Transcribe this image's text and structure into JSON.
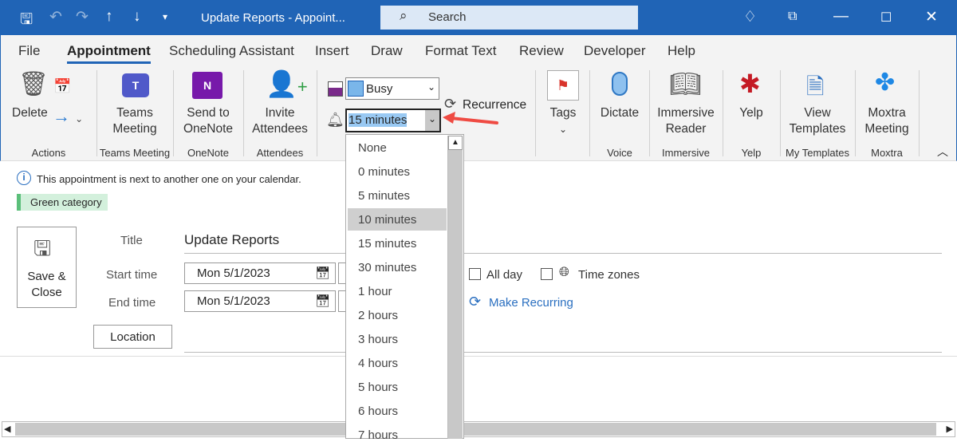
{
  "titlebar": {
    "title": "Update Reports  -  Appoint...",
    "search_placeholder": "Search"
  },
  "menu": {
    "tabs": [
      "File",
      "Appointment",
      "Scheduling Assistant",
      "Insert",
      "Draw",
      "Format Text",
      "Review",
      "Developer",
      "Help"
    ],
    "active": "Appointment"
  },
  "ribbon": {
    "delete": "Delete",
    "teams": [
      "Teams",
      "Meeting"
    ],
    "onenote": [
      "Send to",
      "OneNote"
    ],
    "invite": [
      "Invite",
      "Attendees"
    ],
    "show_as": "Busy",
    "reminder": "15 minutes",
    "recurrence": "Recurrence",
    "tags": "Tags",
    "dictate": "Dictate",
    "immersive": [
      "Immersive",
      "Reader"
    ],
    "yelp": "Yelp",
    "templates": [
      "View",
      "Templates"
    ],
    "moxtra": [
      "Moxtra",
      "Meeting"
    ],
    "groups": [
      "Actions",
      "Teams Meeting",
      "OneNote",
      "Attendees",
      "Voice",
      "Immersive",
      "Yelp",
      "My Templates",
      "Moxtra"
    ]
  },
  "reminder_options": [
    "None",
    "0 minutes",
    "5 minutes",
    "10 minutes",
    "15 minutes",
    "30 minutes",
    "1 hour",
    "2 hours",
    "3 hours",
    "4 hours",
    "5 hours",
    "6 hours",
    "7 hours"
  ],
  "highlighted_option": "10 minutes",
  "form": {
    "info": "This appointment is next to another one on your calendar.",
    "category": "Green category",
    "category_color": "#5bbf7a",
    "save_close": [
      "Save &",
      "Close"
    ],
    "title_label": "Title",
    "title_value": "Update Reports",
    "start_label": "Start time",
    "start_date": "Mon 5/1/2023",
    "end_label": "End time",
    "end_date": "Mon 5/1/2023",
    "all_day": "All day",
    "time_zones": "Time zones",
    "make_recurring": "Make Recurring",
    "location": "Location"
  }
}
